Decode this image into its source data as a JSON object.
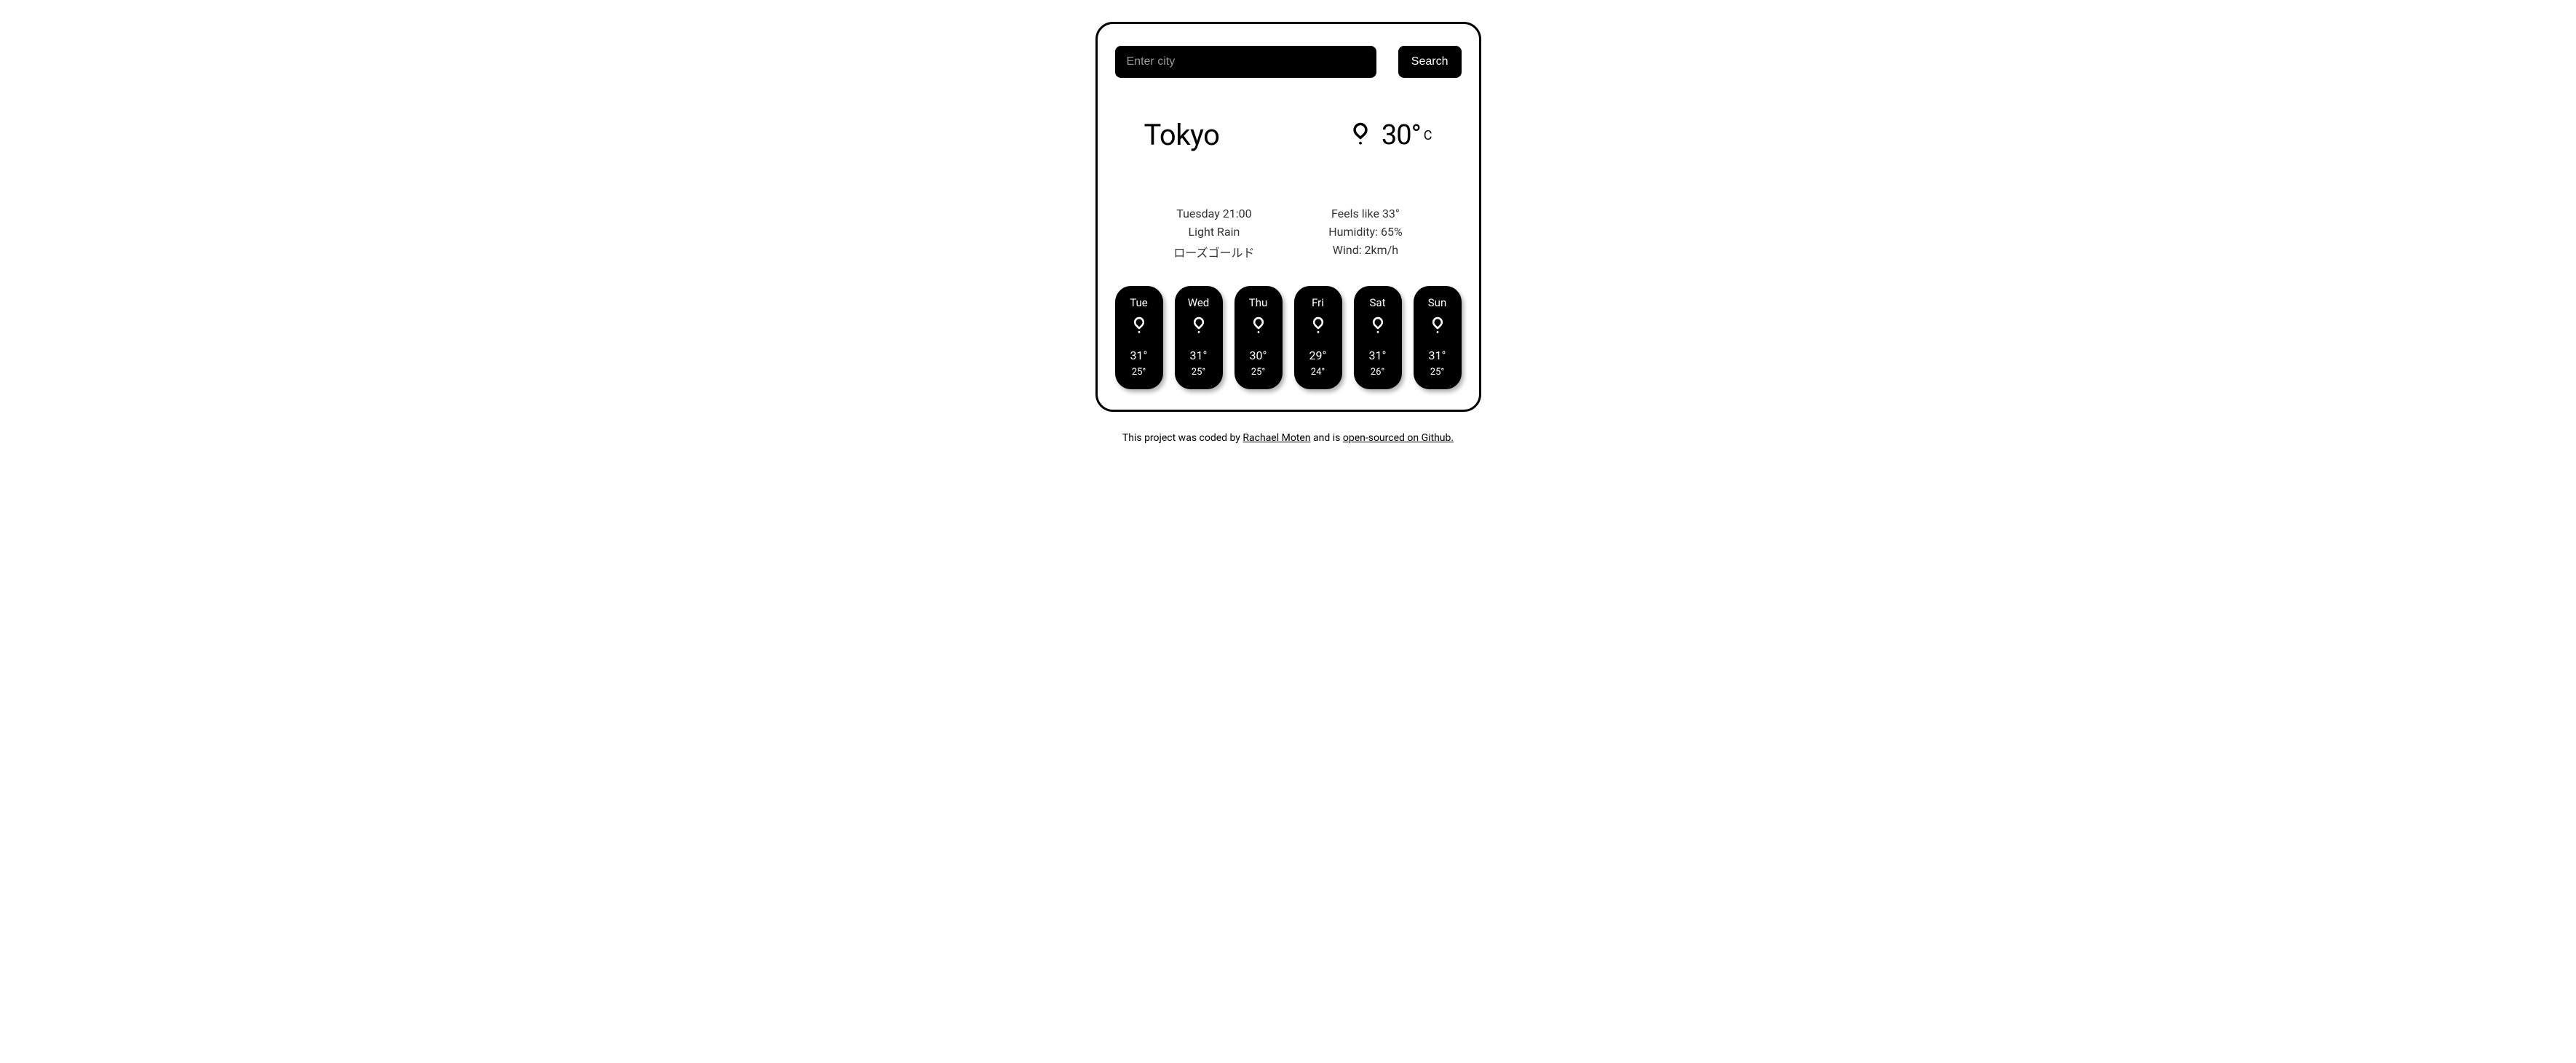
{
  "search": {
    "placeholder": "Enter city",
    "button_label": "Search"
  },
  "current": {
    "city": "Tokyo",
    "temp": "30°",
    "unit": "C",
    "datetime": "Tuesday 21:00",
    "condition": "Light Rain",
    "extra_line": "ローズゴールド",
    "feels_like": "Feels like 33°",
    "humidity": "Humidity: 65%",
    "wind": "Wind: 2km/h"
  },
  "forecast": [
    {
      "day": "Tue",
      "high": "31°",
      "low": "25°",
      "icon": "rain-drizzle"
    },
    {
      "day": "Wed",
      "high": "31°",
      "low": "25°",
      "icon": "rain-drizzle"
    },
    {
      "day": "Thu",
      "high": "30°",
      "low": "25°",
      "icon": "rain-drizzle"
    },
    {
      "day": "Fri",
      "high": "29°",
      "low": "24°",
      "icon": "rain-drizzle"
    },
    {
      "day": "Sat",
      "high": "31°",
      "low": "26°",
      "icon": "rain-drizzle"
    },
    {
      "day": "Sun",
      "high": "31°",
      "low": "25°",
      "icon": "rain-drizzle"
    }
  ],
  "footer": {
    "prefix": "This project was coded by ",
    "author": "Rachael Moten",
    "middle": " and is ",
    "link_text": "open-sourced on Github."
  }
}
